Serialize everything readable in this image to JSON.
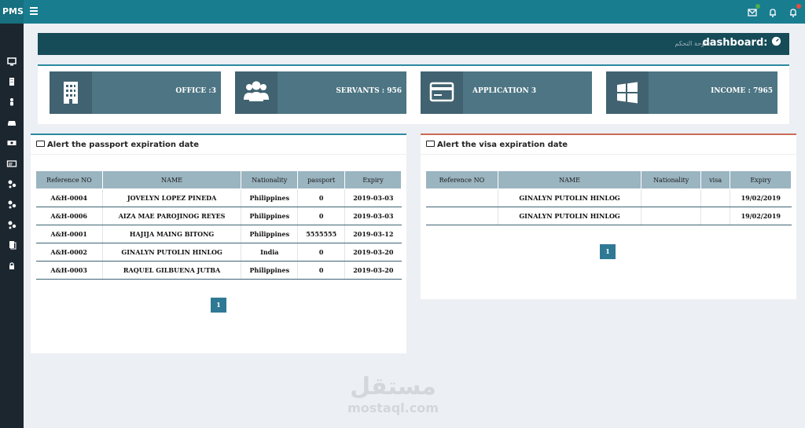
{
  "app": {
    "brand": "PMS"
  },
  "topbar": {
    "icons": [
      {
        "name": "mail-icon",
        "badge_color": "#4caf50"
      },
      {
        "name": "bell-icon"
      },
      {
        "name": "bell-alert-icon",
        "badge_color": "#e74c3c"
      }
    ]
  },
  "sidebar": {
    "icons": [
      "monitor-icon",
      "building-icon",
      "person-icon",
      "car-icon",
      "money-icon",
      "card-icon",
      "gears-icon",
      "gears-icon",
      "gears-icon",
      "document-icon",
      "lock-icon"
    ]
  },
  "dashboard": {
    "title": "dashboard:",
    "subtitle": "لوحة التحكم :"
  },
  "cards": [
    {
      "label": "OFFICE :3",
      "icon": "office-icon"
    },
    {
      "label": "SERVANTS : 956",
      "icon": "users-icon"
    },
    {
      "label": "APPLICATION 3",
      "icon": "credit-card-icon"
    },
    {
      "label": "INCOME : 7965",
      "icon": "windows-icon"
    }
  ],
  "passport_panel": {
    "title": "Alert the passport expiration date",
    "columns": [
      "Reference NO",
      "NAME",
      "Nationality",
      "passport",
      "Expiry"
    ],
    "rows": [
      [
        "A&H-0004",
        "JOVELYN LOPEZ PINEDA",
        "Philippines",
        "0",
        "2019-03-03"
      ],
      [
        "A&H-0006",
        "AIZA MAE PAROJINOG REYES",
        "Philippines",
        "0",
        "2019-03-03"
      ],
      [
        "A&H-0001",
        "HAJIJA MAING BITONG",
        "Philippines",
        "5555555",
        "2019-03-12"
      ],
      [
        "A&H-0002",
        "GINALYN PUTOLIN HINLOG",
        "India",
        "0",
        "2019-03-20"
      ],
      [
        "A&H-0003",
        "RAQUEL GILBUENA JUTBA",
        "Philippines",
        "0",
        "2019-03-20"
      ]
    ],
    "page": "1"
  },
  "visa_panel": {
    "title": "Alert the visa expiration date",
    "columns": [
      "Reference NO",
      "NAME",
      "Nationality",
      "visa",
      "Expiry"
    ],
    "rows": [
      [
        "",
        "GINALYN PUTOLIN HINLOG",
        "",
        "",
        "19/02/2019"
      ],
      [
        "",
        "GINALYN PUTOLIN HINLOG",
        "",
        "",
        "19/02/2019"
      ]
    ],
    "page": "1"
  },
  "watermark": {
    "arabic": "مستقل",
    "latin": "mostaql.com"
  },
  "colors": {
    "topbar": "#197d90",
    "sidebar": "#1c262f",
    "card": "#4d7583",
    "header": "#164b58",
    "table_header": "#9ab4c0",
    "pager": "#2f7995"
  }
}
